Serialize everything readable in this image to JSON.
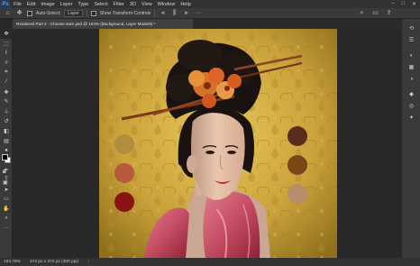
{
  "menubar": {
    "logo": "Ps",
    "items": [
      "File",
      "Edit",
      "Image",
      "Layer",
      "Type",
      "Select",
      "Filter",
      "3D",
      "View",
      "Window",
      "Help"
    ],
    "controls": [
      "–",
      "□",
      "✕"
    ]
  },
  "options": {
    "auto_select_label": "Auto-Select:",
    "layer_select": "Layer",
    "show_transform_label": "Show Transform Controls"
  },
  "document": {
    "tab_title": "Rendered Part 2 - Choose swm.psd @ 104% (Background, Layer Mode/8) *"
  },
  "status": {
    "zoom": "103.78%",
    "doc_info": "474 px x 372 px (300 ppi)"
  },
  "palette": {
    "left_swatches": [
      "#b18e3f",
      "#b85a3a",
      "#8a1414"
    ],
    "right_swatches": [
      "#5a2c1d",
      "#7b4718",
      "#b88e6a"
    ]
  },
  "colors": {
    "background_gold": "#c9a23a",
    "kimono_pink": "#c64d63",
    "hair": "#1a1210",
    "skin": "#e6bfa6"
  },
  "icons": {
    "tools": [
      "move-icon",
      "marquee-icon",
      "lasso-icon",
      "magic-wand-icon",
      "crop-icon",
      "eyedropper-icon",
      "healing-icon",
      "brush-icon",
      "clone-stamp-icon",
      "history-brush-icon",
      "eraser-icon",
      "gradient-icon",
      "blur-icon",
      "dodge-icon",
      "pen-icon",
      "type-icon",
      "path-select-icon",
      "rectangle-icon",
      "hand-icon",
      "zoom-icon"
    ]
  }
}
